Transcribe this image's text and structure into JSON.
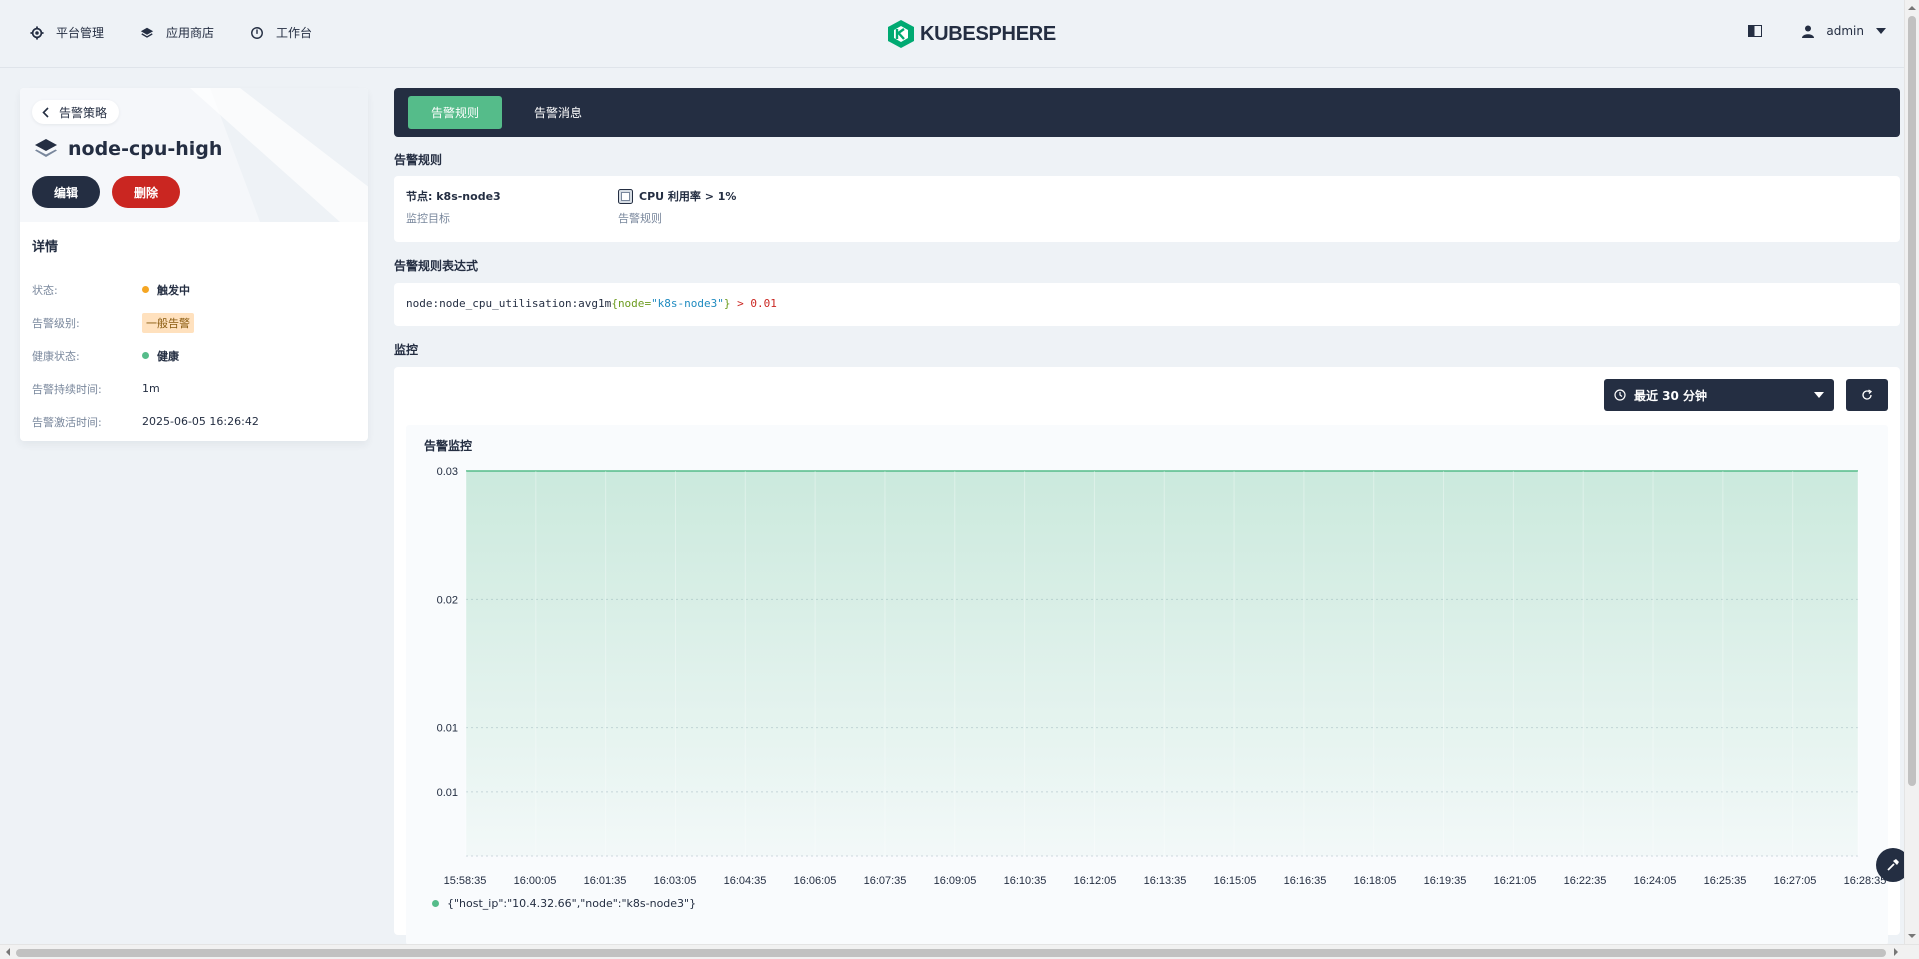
{
  "header": {
    "nav": [
      {
        "label": "平台管理",
        "icon": "gear-icon"
      },
      {
        "label": "应用商店",
        "icon": "layers-icon"
      },
      {
        "label": "工作台",
        "icon": "dashboard-icon"
      }
    ],
    "logo_text": "KUBESPHERE",
    "user": "admin"
  },
  "left": {
    "back_label": "告警策略",
    "title": "node-cpu-high",
    "edit_label": "编辑",
    "delete_label": "删除",
    "details_title": "详情",
    "details": [
      {
        "label": "状态:",
        "value": "触发中"
      },
      {
        "label": "告警级别:",
        "value": "一般告警"
      },
      {
        "label": "健康状态:",
        "value": "健康"
      },
      {
        "label": "告警持续时间:",
        "value": "1m"
      },
      {
        "label": "告警激活时间:",
        "value": "2025-06-05 16:26:42"
      }
    ],
    "colors": {
      "firing": "#f5a623",
      "healthy": "#55bc8a"
    }
  },
  "tabs": [
    {
      "label": "告警规则",
      "active": true
    },
    {
      "label": "告警消息",
      "active": false
    }
  ],
  "rules": {
    "section_title": "告警规则",
    "target_value": "节点: k8s-node3",
    "target_label": "监控目标",
    "rule_value": "CPU 利用率 > 1%",
    "rule_label": "告警规则"
  },
  "expression": {
    "section_title": "告警规则表达式",
    "metric": "node:node_cpu_utilisation:avg1m",
    "open_brace": "{",
    "key": "node",
    "eq": "=",
    "val": "\"k8s-node3\"",
    "close_brace": "}",
    "op": " > ",
    "threshold": "0.01"
  },
  "monitoring": {
    "section_title": "监控",
    "time_range": "最近 30 分钟",
    "chart_title": "告警监控",
    "legend": "{\"host_ip\":\"10.4.32.66\",\"node\":\"k8s-node3\"}"
  },
  "chart_data": {
    "type": "area",
    "title": "告警监控",
    "x": [
      "15:58:35",
      "16:00:05",
      "16:01:35",
      "16:03:05",
      "16:04:35",
      "16:06:05",
      "16:07:35",
      "16:09:05",
      "16:10:35",
      "16:12:05",
      "16:13:35",
      "16:15:05",
      "16:16:35",
      "16:18:05",
      "16:19:35",
      "16:21:05",
      "16:22:35",
      "16:24:05",
      "16:25:35",
      "16:27:05",
      "16:28:35"
    ],
    "y_ticks": [
      {
        "label": "0.03",
        "value": 0.03
      },
      {
        "label": "0.02",
        "value": 0.02
      },
      {
        "label": "0.01",
        "value": 0.01
      },
      {
        "label": "0.01",
        "value": 0.005
      }
    ],
    "ylim": [
      0,
      0.03
    ],
    "series": [
      {
        "name": "{\"host_ip\":\"10.4.32.66\",\"node\":\"k8s-node3\"}",
        "values": [
          0.03,
          0.03,
          0.03,
          0.03,
          0.03,
          0.03,
          0.03,
          0.03,
          0.03,
          0.03,
          0.03,
          0.03,
          0.03,
          0.03,
          0.03,
          0.03,
          0.03,
          0.03,
          0.03,
          0.03,
          0.03
        ]
      }
    ],
    "color": "#55bc8a",
    "grid": true
  }
}
